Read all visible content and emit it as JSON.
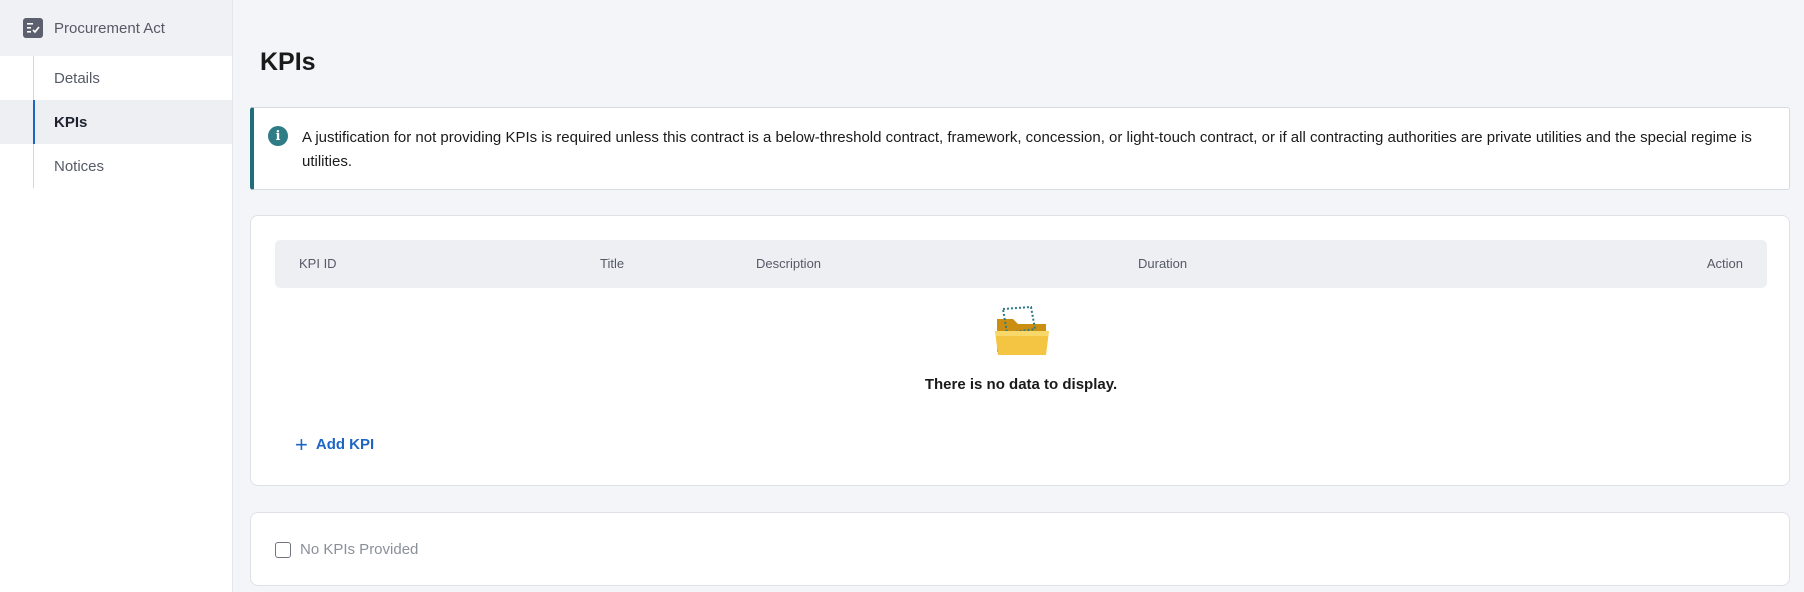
{
  "sidebar": {
    "title": "Procurement Act",
    "items": [
      {
        "label": "Details"
      },
      {
        "label": "KPIs"
      },
      {
        "label": "Notices"
      }
    ]
  },
  "main": {
    "title": "KPIs",
    "alert": {
      "icon": "info-icon",
      "text": "A justification for not providing KPIs is required unless this contract is a below-threshold contract, framework, concession, or light-touch contract, or if all contracting authorities are private utilities and the special regime is utilities."
    },
    "table": {
      "columns": [
        "KPI ID",
        "Title",
        "Description",
        "Duration",
        "Action"
      ],
      "empty_text": "There is no data to display."
    },
    "add_button": {
      "label": "Add KPI"
    },
    "checkbox": {
      "label": "No KPIs Provided"
    }
  },
  "colors": {
    "accent": "#1d66c4",
    "alert_border": "#1f6f7a"
  }
}
